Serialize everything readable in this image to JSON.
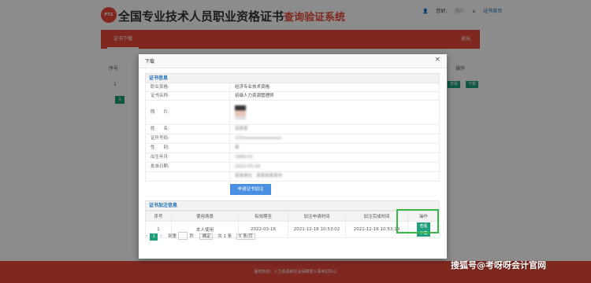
{
  "header": {
    "logo_text": "PTG",
    "title": "全国专业技术人员职业资格证书",
    "subtitle": "查询验证系统",
    "user_text": "您好,",
    "user_name": "用户",
    "cert_home": "证书首页"
  },
  "nav": {
    "active_tab": "证书下载",
    "exit": "退出"
  },
  "background": {
    "col_no": "序号",
    "col_action": "操作",
    "row_no": "1",
    "btn_view": "查看",
    "btn_download": "下载",
    "page_num": "1"
  },
  "modal": {
    "title": "下载",
    "close": "×",
    "cert_info_title": "证书信息",
    "rows": [
      {
        "label": "职业资格:",
        "value": "经济专业技术资格"
      },
      {
        "label": "证书名称:",
        "value": "初级人力资源管理师"
      },
      {
        "label": "照　　片:",
        "value": ""
      },
      {
        "label": "姓　　名:",
        "value": "张某某"
      },
      {
        "label": "证件号码:",
        "value": "110xxxxxxxxxxxxxxx"
      },
      {
        "label": "性　　别:",
        "value": "男"
      },
      {
        "label": "出生年月:",
        "value": "1990-01"
      },
      {
        "label": "批准日期:",
        "value": "2022-03-16"
      },
      {
        "label": "",
        "value": "某某单位 · 某某省某某市"
      }
    ],
    "apply_button": "申请证书加注",
    "remark_title": "证书加注信息",
    "remark_headers": [
      "序号",
      "使用场景",
      "有效期至",
      "加注申请时间",
      "加注完成时间",
      "操作"
    ],
    "remark_rows": [
      {
        "no": "1",
        "scene": "本人使用",
        "expire": "2022-03-16",
        "apply_time": "2021-12-16 10:53:02",
        "done_time": "2021-12-16 10:53:19"
      }
    ],
    "action_view": "查看",
    "action_download": "下载",
    "pager": {
      "current": "1",
      "goto_label": "到第",
      "page_input": "1",
      "page_suffix": "页",
      "confirm": "确定",
      "total": "共 1 条",
      "per_page": "5 条/页"
    }
  },
  "footer": {
    "text": "版权所有：人力资源和社会保障部人事考试中心"
  },
  "watermark": {
    "text": "搜狐号@考呀呀会计官网"
  }
}
